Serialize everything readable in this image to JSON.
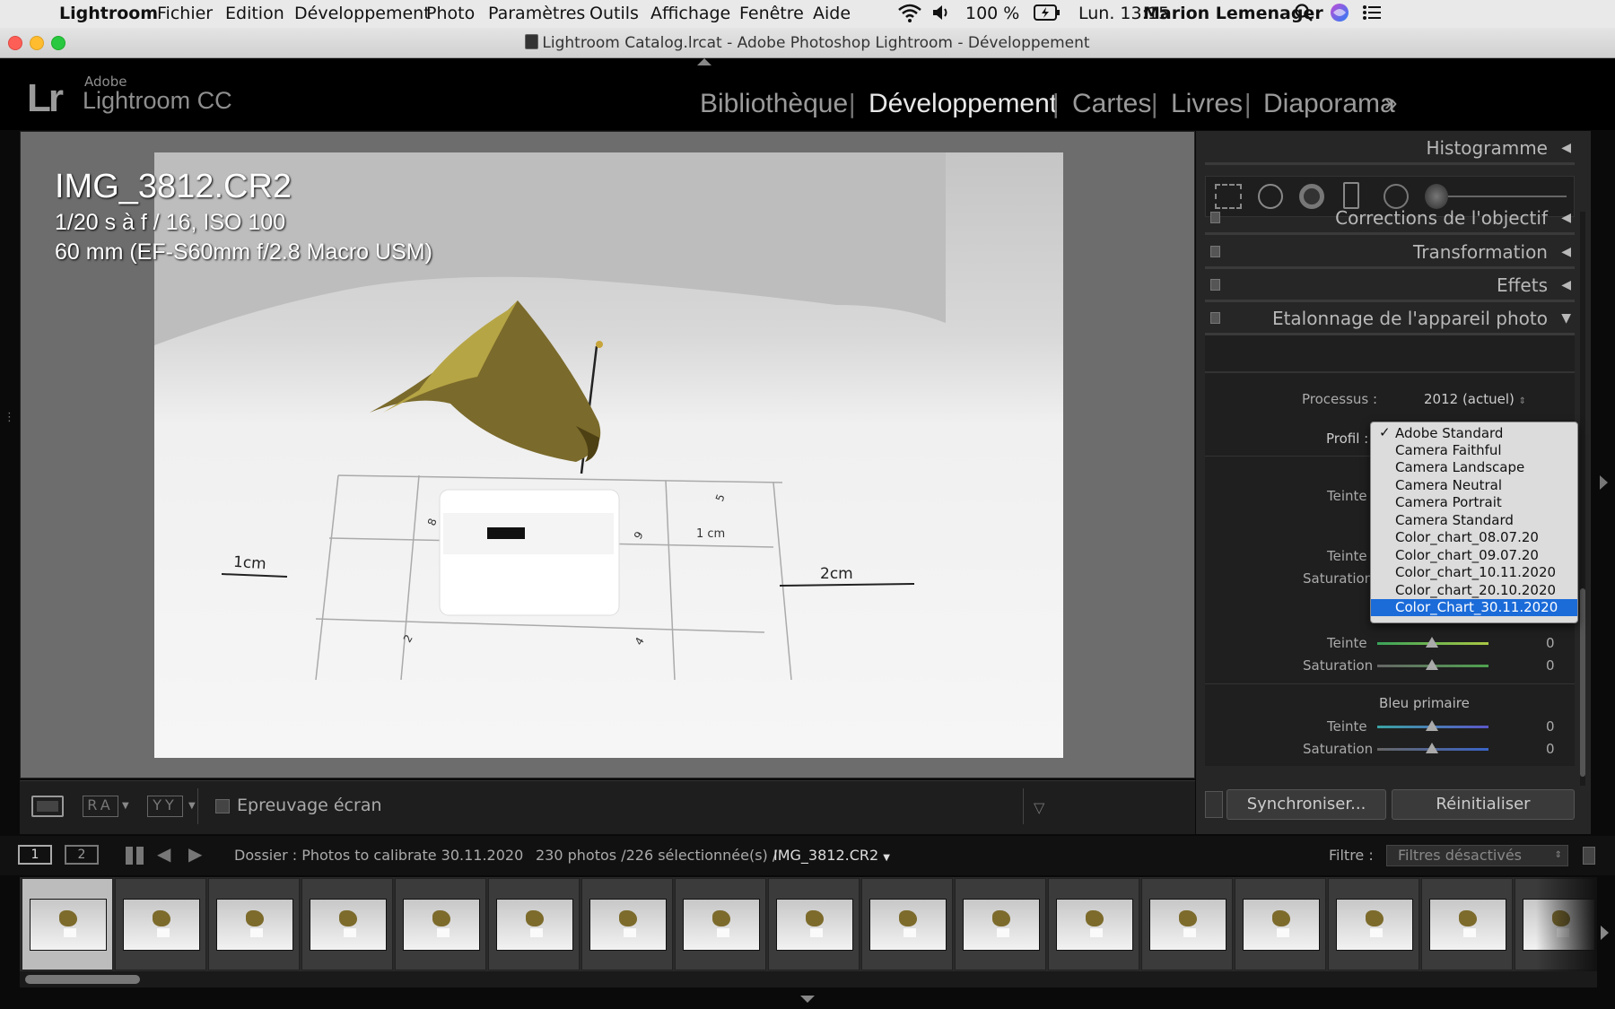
{
  "menubar": {
    "apple": "",
    "app": "Lightroom",
    "items": [
      "Fichier",
      "Edition",
      "Développement",
      "Photo",
      "Paramètres",
      "Outils",
      "Affichage",
      "Fenêtre",
      "Aide"
    ],
    "battery": "100 %",
    "clock": "Lun. 13:15",
    "user": "Marion Lemenager"
  },
  "window": {
    "title": "Lightroom Catalog.lrcat - Adobe Photoshop Lightroom - Développement"
  },
  "lr": {
    "logo": "Lr",
    "adobe": "Adobe",
    "product": "Lightroom CC",
    "modules": [
      "Bibliothèque",
      "Développement",
      "Cartes",
      "Livres",
      "Diaporama"
    ],
    "more": "»",
    "active_module": "Développement"
  },
  "photo_info": {
    "filename": "IMG_3812.CR2",
    "exposure": "1/20 s à f / 16, ISO 100",
    "lens": "60 mm (EF-S60mm f/2.8 Macro USM)"
  },
  "photo_labels": {
    "label_1cm_box": "1 cm",
    "label_1cm": "1cm",
    "label_2cm": "2cm",
    "mark_8": "8",
    "mark_9": "9",
    "mark_5": "5",
    "mark_4": "4",
    "mark_2": "2"
  },
  "toolbar": {
    "proof_label": "Epreuvage écran",
    "ra": "RA",
    "yy": "YY"
  },
  "right_panel": {
    "histogram": "Histogramme",
    "lens_corrections": "Corrections de l'objectif",
    "transform": "Transformation",
    "effects": "Effets",
    "calibration": "Etalonnage de l'appareil photo",
    "process_label": "Processus :",
    "process_value": "2012 (actuel)",
    "profile_label": "Profil :",
    "tint_label": "Teinte",
    "saturation_label": "Saturation",
    "blue_primary": "Bleu primaire",
    "zero": "0",
    "sync_button": "Synchroniser...",
    "reset_button": "Réinitialiser"
  },
  "profile_dropdown": {
    "check": "✓",
    "options": [
      "Adobe Standard",
      "Camera Faithful",
      "Camera Landscape",
      "Camera Neutral",
      "Camera Portrait",
      "Camera Standard",
      "Color_chart_08.07.20",
      "Color_chart_09.07.20",
      "Color_chart_10.11.2020",
      "Color_chart_20.10.2020",
      "Color_Chart_30.11.2020"
    ],
    "checked_index": 0,
    "highlighted_index": 10
  },
  "filmstrip_bar": {
    "view1": "1",
    "view2": "2",
    "source": "Dossier : Photos to calibrate 30.11.2020",
    "count": "230 photos /226 sélectionnée(s) /",
    "current_file": "IMG_3812.CR2",
    "filter_label": "Filtre :",
    "filter_value": "Filtres désactivés"
  },
  "colors": {
    "accent": "#1b6bd9",
    "panel": "#262626",
    "background": "#0a0a0a"
  }
}
